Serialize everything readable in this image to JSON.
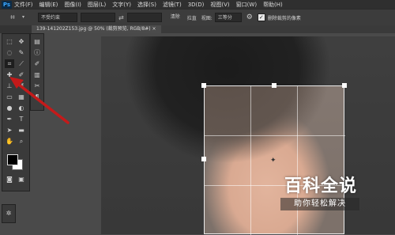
{
  "app": {
    "logo": "Ps"
  },
  "menubar": {
    "items": [
      "文件(F)",
      "编辑(E)",
      "图像(I)",
      "图层(L)",
      "文字(Y)",
      "选择(S)",
      "滤镜(T)",
      "3D(D)",
      "视图(V)",
      "窗口(W)",
      "帮助(H)"
    ]
  },
  "options": {
    "ratio_select": "不受约束",
    "clear_button": "清除",
    "straighten_label": "拉直",
    "view_label": "视图:",
    "view_select": "三等分",
    "delete_crop_checked": true,
    "delete_crop_label": "删除裁剪的像素",
    "swap_symbol": "⇄",
    "checkbox_glyph": "✓"
  },
  "document": {
    "tab_title": "139-141202Z153.jpg @ 50% (裁剪预览, RGB/8#) ×"
  },
  "tools": {
    "icons": [
      "marquee-icon",
      "move-icon",
      "lasso-icon",
      "quick-select-icon",
      "crop-icon",
      "eyedropper-icon",
      "healing-icon",
      "brush-icon",
      "clone-stamp-icon",
      "history-brush-icon",
      "eraser-icon",
      "gradient-icon",
      "blur-icon",
      "dodge-icon",
      "pen-icon",
      "type-icon",
      "path-select-icon",
      "shape-icon",
      "hand-icon",
      "zoom-icon"
    ],
    "active_tool": "crop-icon"
  },
  "colors": {
    "annotation_arrow": "#c41a1a",
    "foreground": "#000000",
    "background": "#ffffff"
  },
  "watermark": {
    "title": "百科全说",
    "subtitle": "助你轻松解决"
  }
}
